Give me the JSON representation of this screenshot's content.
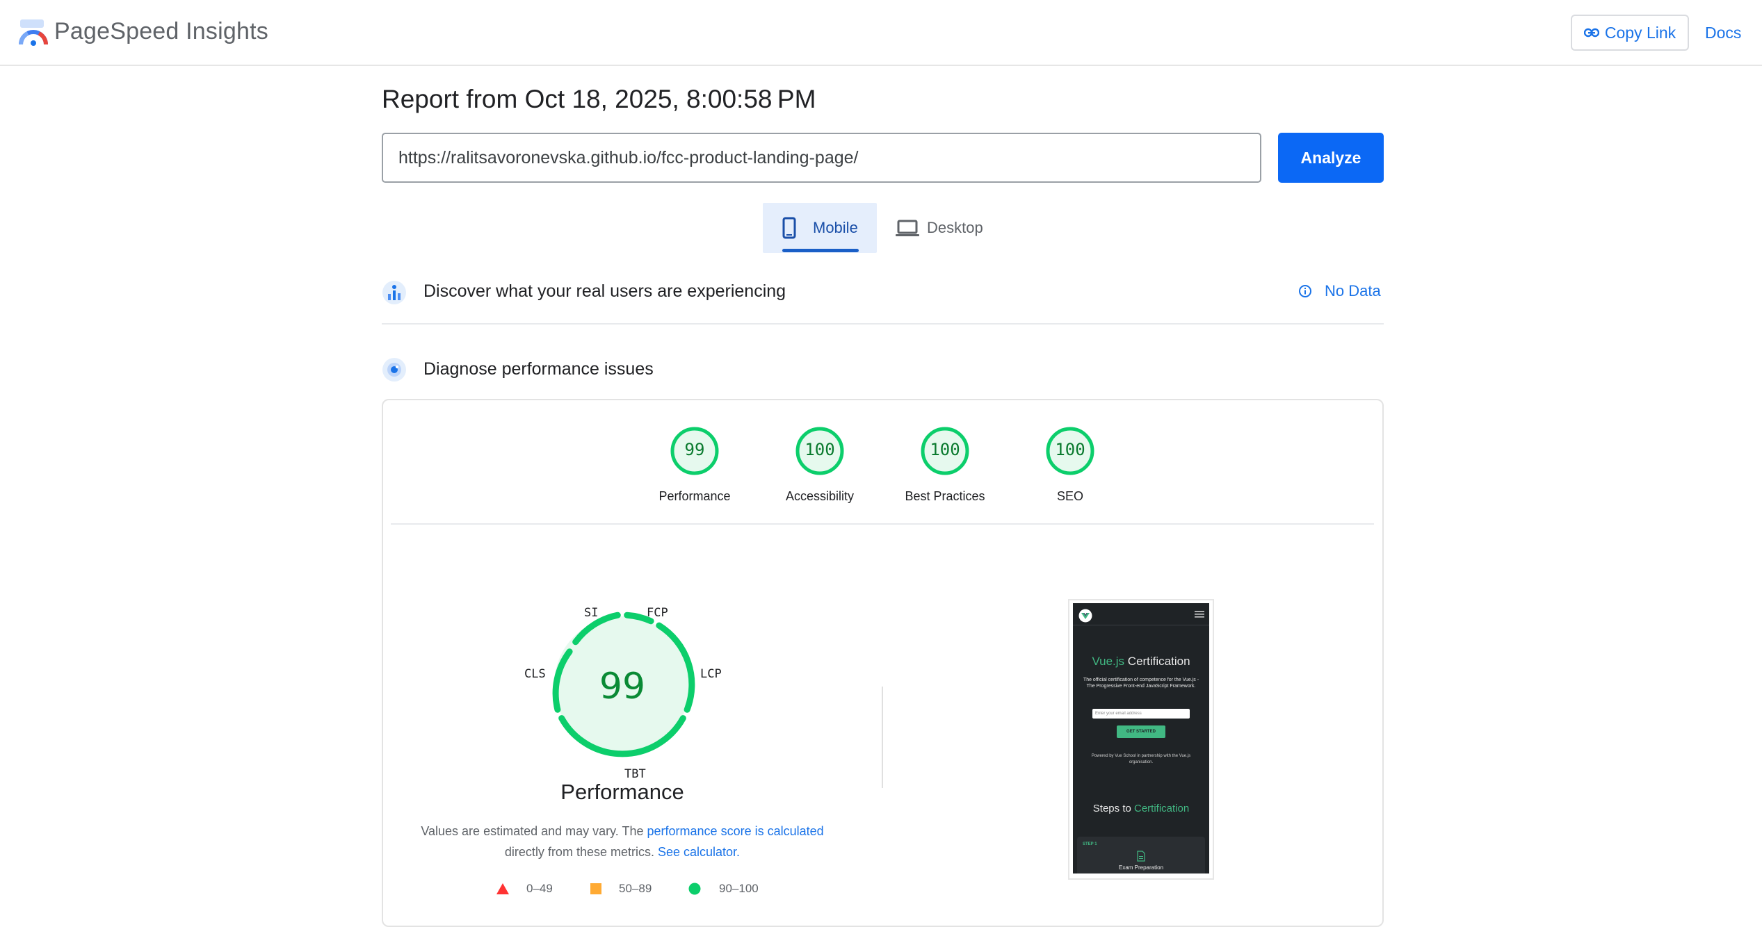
{
  "header": {
    "app_title": "PageSpeed Insights",
    "copy_link": "Copy Link",
    "docs": "Docs",
    "logo_icon": "pagespeed-logo",
    "link_icon": "link-icon"
  },
  "report": {
    "title": "Report from Oct 18, 2025, 8:00:58 PM",
    "url": "https://ralitsavoronevska.github.io/fcc-product-landing-page/",
    "analyze": "Analyze"
  },
  "tabs": [
    {
      "label": "Mobile",
      "icon": "phone-icon",
      "selected": true
    },
    {
      "label": "Desktop",
      "icon": "laptop-icon",
      "selected": false
    }
  ],
  "real_users": {
    "title": "Discover what your real users are experiencing",
    "no_data": "No Data",
    "icon": "users-chart-icon"
  },
  "diagnose": {
    "title": "Diagnose performance issues",
    "icon": "diagnose-icon"
  },
  "scores": [
    {
      "label": "Performance",
      "score": "99"
    },
    {
      "label": "Accessibility",
      "score": "100"
    },
    {
      "label": "Best Practices",
      "score": "100"
    },
    {
      "label": "SEO",
      "score": "100"
    }
  ],
  "performance": {
    "score": "99",
    "title": "Performance",
    "metrics": [
      "SI",
      "FCP",
      "LCP",
      "TBT",
      "CLS"
    ],
    "note_prefix": "Values are estimated and may vary. The ",
    "note_link1": "performance score is calculated",
    "note_middle": " directly from these metrics. ",
    "note_link2": "See calculator.",
    "legend": [
      {
        "label": "0–49",
        "color": "#ff3333",
        "shape": "triangle"
      },
      {
        "label": "50–89",
        "color": "#ffaa33",
        "shape": "square"
      },
      {
        "label": "90–100",
        "color": "#0cce6b",
        "shape": "circle"
      }
    ]
  },
  "thumbnail": {
    "heading_accent": "Vue.js",
    "heading_rest": " Certification",
    "subtitle": "The official certification of competence for the Vue.js - The Progressive Front-end JavaScript Framework.",
    "email_placeholder": "Enter your email address",
    "cta": "GET STARTED",
    "powered": "Powered by Vue School in partnership with the Vue.js organisation.",
    "steps_prefix": "Steps to ",
    "steps_accent": "Certification",
    "step_label": "STEP 1",
    "step_title": "Exam Preparation"
  },
  "colors": {
    "accent": "#1a73e8",
    "analyze_bg": "#0b68f5",
    "pass": "#0cce6b",
    "vue_green": "#41b883"
  }
}
